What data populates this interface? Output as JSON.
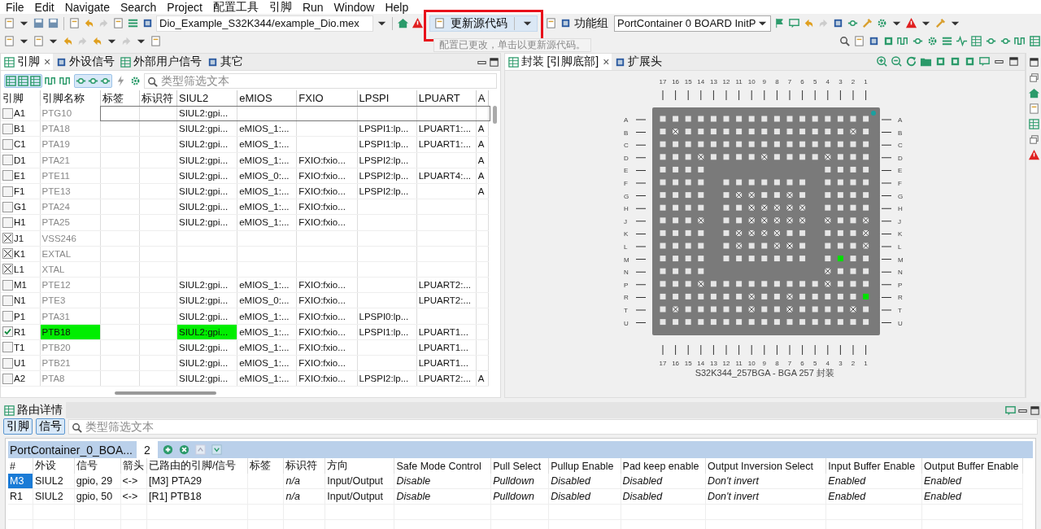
{
  "menu": [
    {
      "label": "File"
    },
    {
      "label": "Edit"
    },
    {
      "label": "Navigate"
    },
    {
      "label": "Search"
    },
    {
      "label": "Project"
    },
    {
      "label": "配置工具"
    },
    {
      "label": "引脚"
    },
    {
      "label": "Run"
    },
    {
      "label": "Window"
    },
    {
      "label": "Help"
    }
  ],
  "toolbar": {
    "project_combo": "Dio_Example_S32K344/example_Dio.mex",
    "update_button": "更新源代码",
    "function_group_label": "功能组",
    "function_group_combo": "PortContainer 0 BOARD InitP",
    "tooltip": "配置已更改，单击以更新源代码。"
  },
  "pins_view": {
    "tabs": [
      {
        "label": "引脚",
        "selected": true,
        "close": "×"
      },
      {
        "label": "外设信号",
        "selected": false
      },
      {
        "label": "外部用户信号",
        "selected": false
      },
      {
        "label": "其它",
        "selected": false
      }
    ],
    "filter": {
      "placeholder": "类型筛选文本"
    },
    "columns": [
      "引脚",
      "引脚名称",
      "标签",
      "标识符",
      "SIUL2",
      "eMIOS",
      "FXIO",
      "LPSPI",
      "LPUART",
      "A"
    ],
    "rows": [
      {
        "kind": "pin",
        "checked": false,
        "selected": true,
        "routed": false,
        "cells": [
          "A1",
          "PTG10",
          null,
          null,
          "SIUL2:gpi...",
          null,
          null,
          null,
          null,
          null
        ]
      },
      {
        "kind": "pin",
        "checked": false,
        "selected": false,
        "routed": false,
        "cells": [
          "B1",
          "PTA18",
          null,
          null,
          "SIUL2:gpi...",
          "eMIOS_1:...",
          null,
          "LPSPI1:lp...",
          "LPUART1:...",
          "A"
        ]
      },
      {
        "kind": "pin",
        "checked": false,
        "selected": false,
        "routed": false,
        "cells": [
          "C1",
          "PTA19",
          null,
          null,
          "SIUL2:gpi...",
          "eMIOS_1:...",
          null,
          "LPSPI1:lp...",
          "LPUART1:...",
          "A"
        ]
      },
      {
        "kind": "pin",
        "checked": false,
        "selected": false,
        "routed": false,
        "cells": [
          "D1",
          "PTA21",
          null,
          null,
          "SIUL2:gpi...",
          "eMIOS_1:...",
          "FXIO:fxio...",
          "LPSPI2:lp...",
          null,
          "A"
        ]
      },
      {
        "kind": "pin",
        "checked": false,
        "selected": false,
        "routed": false,
        "cells": [
          "E1",
          "PTE11",
          null,
          null,
          "SIUL2:gpi...",
          "eMIOS_0:...",
          "FXIO:fxio...",
          "LPSPI2:lp...",
          "LPUART4:...",
          "A"
        ]
      },
      {
        "kind": "pin",
        "checked": false,
        "selected": false,
        "routed": false,
        "cells": [
          "F1",
          "PTE13",
          null,
          null,
          "SIUL2:gpi...",
          "eMIOS_1:...",
          "FXIO:fxio...",
          "LPSPI2:lp...",
          null,
          "A"
        ]
      },
      {
        "kind": "pin",
        "checked": false,
        "selected": false,
        "routed": false,
        "cells": [
          "G1",
          "PTA24",
          null,
          null,
          "SIUL2:gpi...",
          "eMIOS_1:...",
          "FXIO:fxio...",
          null,
          null,
          null
        ]
      },
      {
        "kind": "pin",
        "checked": false,
        "selected": false,
        "routed": false,
        "cells": [
          "H1",
          "PTA25",
          null,
          null,
          "SIUL2:gpi...",
          "eMIOS_1:...",
          "FXIO:fxio...",
          null,
          null,
          null
        ]
      },
      {
        "kind": "power",
        "selected": false,
        "routed": false,
        "cells": [
          "J1",
          "VSS246",
          null,
          null,
          null,
          null,
          null,
          null,
          null,
          null
        ]
      },
      {
        "kind": "power",
        "selected": false,
        "routed": false,
        "cells": [
          "K1",
          "EXTAL",
          null,
          null,
          null,
          null,
          null,
          null,
          null,
          null
        ]
      },
      {
        "kind": "power",
        "selected": false,
        "routed": false,
        "cells": [
          "L1",
          "XTAL",
          null,
          null,
          null,
          null,
          null,
          null,
          null,
          null
        ]
      },
      {
        "kind": "pin",
        "checked": false,
        "selected": false,
        "routed": false,
        "cells": [
          "M1",
          "PTE12",
          null,
          null,
          "SIUL2:gpi...",
          "eMIOS_1:...",
          "FXIO:fxio...",
          null,
          "LPUART2:...",
          null
        ]
      },
      {
        "kind": "pin",
        "checked": false,
        "selected": false,
        "routed": false,
        "cells": [
          "N1",
          "PTE3",
          null,
          null,
          "SIUL2:gpi...",
          "eMIOS_0:...",
          "FXIO:fxio...",
          null,
          "LPUART2:...",
          null
        ]
      },
      {
        "kind": "pin",
        "checked": false,
        "selected": false,
        "routed": false,
        "cells": [
          "P1",
          "PTA31",
          null,
          null,
          "SIUL2:gpi...",
          "eMIOS_1:...",
          "FXIO:fxio...",
          "LPSPI0:lp...",
          null,
          null
        ]
      },
      {
        "kind": "pin",
        "checked": true,
        "selected": false,
        "routed": true,
        "cells": [
          "R1",
          "PTB18",
          null,
          null,
          "SIUL2:gpi...",
          "eMIOS_1:...",
          "FXIO:fxio...",
          "LPSPI1:lp...",
          "LPUART1...",
          null
        ]
      },
      {
        "kind": "pin",
        "checked": false,
        "selected": false,
        "routed": false,
        "cells": [
          "T1",
          "PTB20",
          null,
          null,
          "SIUL2:gpi...",
          "eMIOS_1:...",
          "FXIO:fxio...",
          null,
          "LPUART1...",
          null
        ]
      },
      {
        "kind": "pin",
        "checked": false,
        "selected": false,
        "routed": false,
        "cells": [
          "U1",
          "PTB21",
          null,
          null,
          "SIUL2:gpi...",
          "eMIOS_1:...",
          "FXIO:fxio...",
          null,
          "LPUART1...",
          null
        ]
      },
      {
        "kind": "pin",
        "checked": false,
        "selected": false,
        "routed": false,
        "cells": [
          "A2",
          "PTA8",
          null,
          null,
          "SIUL2:gpi...",
          "eMIOS_1:...",
          "FXIO:fxio...",
          "LPSPI2:lp...",
          "LPUART2:...",
          "A"
        ]
      }
    ]
  },
  "package_view": {
    "tabs": [
      {
        "label": "封装 [引脚底部]",
        "selected": true,
        "close": "×"
      },
      {
        "label": "扩展头",
        "selected": false
      }
    ],
    "top_labels": [
      "17",
      "16",
      "15",
      "14",
      "13",
      "12",
      "11",
      "10",
      "9",
      "8",
      "7",
      "6",
      "5",
      "4",
      "3",
      "2",
      "1"
    ],
    "bottom_labels": [
      "17",
      "16",
      "15",
      "14",
      "13",
      "12",
      "11",
      "10",
      "9",
      "8",
      "7",
      "6",
      "5",
      "4",
      "3",
      "2",
      "1"
    ],
    "left_labels": [
      "A",
      "B",
      "C",
      "D",
      "E",
      "F",
      "G",
      "H",
      "J",
      "K",
      "L",
      "M",
      "N",
      "P",
      "R",
      "T",
      "U"
    ],
    "right_labels": [
      "A",
      "B",
      "C",
      "D",
      "E",
      "F",
      "G",
      "H",
      "J",
      "K",
      "L",
      "M",
      "N",
      "P",
      "R",
      "T",
      "U"
    ],
    "rows": [
      [
        {
          "kind": "pad"
        },
        {
          "kind": "pad"
        },
        {
          "kind": "pad"
        },
        {
          "kind": "pad"
        },
        {
          "kind": "pad"
        },
        {
          "kind": "pad"
        },
        {
          "kind": "pad"
        },
        {
          "kind": "pad"
        },
        {
          "kind": "pad"
        },
        {
          "kind": "pad"
        },
        {
          "kind": "pad"
        },
        {
          "kind": "pad"
        },
        {
          "kind": "pad"
        },
        {
          "kind": "pad"
        },
        {
          "kind": "pad"
        },
        {
          "kind": "pad"
        },
        {
          "kind": "pad"
        }
      ],
      [
        {
          "kind": "pad"
        },
        {
          "kind": "unavailable"
        },
        {
          "kind": "pad"
        },
        {
          "kind": "pad"
        },
        {
          "kind": "pad"
        },
        {
          "kind": "pad"
        },
        {
          "kind": "pad"
        },
        {
          "kind": "pad"
        },
        {
          "kind": "pad"
        },
        {
          "kind": "pad"
        },
        {
          "kind": "pad"
        },
        {
          "kind": "pad"
        },
        {
          "kind": "pad"
        },
        {
          "kind": "pad"
        },
        {
          "kind": "pad"
        },
        {
          "kind": "unavailable"
        },
        {
          "kind": "pad"
        }
      ],
      [
        {
          "kind": "pad"
        },
        {
          "kind": "pad"
        },
        {
          "kind": "pad"
        },
        {
          "kind": "pad"
        },
        {
          "kind": "pad"
        },
        {
          "kind": "pad"
        },
        {
          "kind": "pad"
        },
        {
          "kind": "pad"
        },
        {
          "kind": "pad"
        },
        {
          "kind": "pad"
        },
        {
          "kind": "pad"
        },
        {
          "kind": "pad"
        },
        {
          "kind": "pad"
        },
        {
          "kind": "pad"
        },
        {
          "kind": "pad"
        },
        {
          "kind": "pad"
        },
        {
          "kind": "pad"
        }
      ],
      [
        {
          "kind": "pad"
        },
        {
          "kind": "pad"
        },
        {
          "kind": "pad"
        },
        {
          "kind": "unavailable"
        },
        {
          "kind": "pad"
        },
        {
          "kind": "pad"
        },
        {
          "kind": "pad"
        },
        {
          "kind": "pad"
        },
        {
          "kind": "unavailable"
        },
        {
          "kind": "pad"
        },
        {
          "kind": "pad"
        },
        {
          "kind": "pad"
        },
        {
          "kind": "pad"
        },
        {
          "kind": "unavailable"
        },
        {
          "kind": "pad"
        },
        {
          "kind": "pad"
        },
        {
          "kind": "pad"
        }
      ],
      [
        {
          "kind": "pad"
        },
        {
          "kind": "pad"
        },
        {
          "kind": "pad"
        },
        {
          "kind": "pad"
        },
        null,
        null,
        null,
        null,
        null,
        null,
        null,
        null,
        null,
        {
          "kind": "pad"
        },
        {
          "kind": "pad"
        },
        {
          "kind": "pad"
        },
        {
          "kind": "pad"
        }
      ],
      [
        {
          "kind": "pad"
        },
        {
          "kind": "pad"
        },
        {
          "kind": "pad"
        },
        {
          "kind": "pad"
        },
        null,
        {
          "kind": "pad"
        },
        {
          "kind": "pad"
        },
        {
          "kind": "pad"
        },
        {
          "kind": "pad"
        },
        {
          "kind": "pad"
        },
        {
          "kind": "pad"
        },
        {
          "kind": "pad"
        },
        null,
        {
          "kind": "pad"
        },
        {
          "kind": "pad"
        },
        {
          "kind": "pad"
        },
        {
          "kind": "pad"
        }
      ],
      [
        {
          "kind": "pad"
        },
        {
          "kind": "pad"
        },
        {
          "kind": "pad"
        },
        {
          "kind": "pad"
        },
        null,
        {
          "kind": "pad"
        },
        {
          "kind": "unavailable"
        },
        {
          "kind": "unavailable"
        },
        {
          "kind": "pad"
        },
        {
          "kind": "pad"
        },
        {
          "kind": "unavailable"
        },
        {
          "kind": "pad"
        },
        null,
        {
          "kind": "pad"
        },
        {
          "kind": "pad"
        },
        {
          "kind": "pad"
        },
        {
          "kind": "pad"
        }
      ],
      [
        {
          "kind": "pad"
        },
        {
          "kind": "pad"
        },
        {
          "kind": "pad"
        },
        {
          "kind": "pad"
        },
        null,
        {
          "kind": "pad"
        },
        {
          "kind": "pad"
        },
        {
          "kind": "unavailable"
        },
        {
          "kind": "unavailable"
        },
        {
          "kind": "unavailable"
        },
        {
          "kind": "unavailable"
        },
        {
          "kind": "unavailable"
        },
        null,
        {
          "kind": "pad"
        },
        {
          "kind": "pad"
        },
        {
          "kind": "pad"
        },
        {
          "kind": "pad"
        }
      ],
      [
        {
          "kind": "pad"
        },
        {
          "kind": "pad"
        },
        {
          "kind": "pad"
        },
        {
          "kind": "unavailable"
        },
        null,
        {
          "kind": "pad"
        },
        {
          "kind": "pad"
        },
        {
          "kind": "unavailable"
        },
        {
          "kind": "unavailable"
        },
        {
          "kind": "unavailable"
        },
        {
          "kind": "unavailable"
        },
        {
          "kind": "unavailable"
        },
        null,
        {
          "kind": "unavailable"
        },
        {
          "kind": "pad"
        },
        {
          "kind": "pad"
        },
        {
          "kind": "unavailable"
        }
      ],
      [
        {
          "kind": "pad"
        },
        {
          "kind": "pad"
        },
        {
          "kind": "pad"
        },
        {
          "kind": "pad"
        },
        null,
        {
          "kind": "pad"
        },
        {
          "kind": "unavailable"
        },
        {
          "kind": "unavailable"
        },
        {
          "kind": "unavailable"
        },
        {
          "kind": "unavailable"
        },
        {
          "kind": "pad"
        },
        {
          "kind": "pad"
        },
        null,
        {
          "kind": "pad"
        },
        {
          "kind": "pad"
        },
        {
          "kind": "pad"
        },
        {
          "kind": "unavailable"
        }
      ],
      [
        {
          "kind": "pad"
        },
        {
          "kind": "pad"
        },
        {
          "kind": "pad"
        },
        {
          "kind": "pad"
        },
        null,
        {
          "kind": "pad"
        },
        {
          "kind": "unavailable"
        },
        {
          "kind": "pad"
        },
        {
          "kind": "pad"
        },
        {
          "kind": "unavailable"
        },
        {
          "kind": "unavailable"
        },
        {
          "kind": "pad"
        },
        null,
        {
          "kind": "pad"
        },
        {
          "kind": "pad"
        },
        {
          "kind": "pad"
        },
        {
          "kind": "unavailable"
        }
      ],
      [
        {
          "kind": "pad"
        },
        {
          "kind": "pad"
        },
        {
          "kind": "pad"
        },
        {
          "kind": "pad"
        },
        null,
        {
          "kind": "pad"
        },
        {
          "kind": "pad"
        },
        {
          "kind": "pad"
        },
        {
          "kind": "pad"
        },
        {
          "kind": "pad"
        },
        {
          "kind": "pad"
        },
        {
          "kind": "pad"
        },
        null,
        {
          "kind": "pad"
        },
        {
          "kind": "routed"
        },
        {
          "kind": "pad"
        },
        {
          "kind": "pad"
        }
      ],
      [
        {
          "kind": "pad"
        },
        {
          "kind": "pad"
        },
        {
          "kind": "pad"
        },
        {
          "kind": "pad"
        },
        null,
        null,
        null,
        null,
        null,
        null,
        null,
        null,
        null,
        {
          "kind": "unavailable"
        },
        {
          "kind": "pad"
        },
        {
          "kind": "pad"
        },
        {
          "kind": "pad"
        }
      ],
      [
        {
          "kind": "pad"
        },
        {
          "kind": "pad"
        },
        {
          "kind": "pad"
        },
        {
          "kind": "unavailable"
        },
        {
          "kind": "pad"
        },
        {
          "kind": "pad"
        },
        {
          "kind": "pad"
        },
        {
          "kind": "pad"
        },
        {
          "kind": "pad"
        },
        {
          "kind": "pad"
        },
        {
          "kind": "pad"
        },
        {
          "kind": "pad"
        },
        {
          "kind": "pad"
        },
        {
          "kind": "unavailable"
        },
        {
          "kind": "pad"
        },
        {
          "kind": "pad"
        },
        {
          "kind": "pad"
        }
      ],
      [
        {
          "kind": "pad"
        },
        {
          "kind": "pad"
        },
        {
          "kind": "pad"
        },
        {
          "kind": "pad"
        },
        {
          "kind": "pad"
        },
        {
          "kind": "pad"
        },
        {
          "kind": "pad"
        },
        {
          "kind": "unavailable"
        },
        {
          "kind": "pad"
        },
        {
          "kind": "pad"
        },
        {
          "kind": "unavailable"
        },
        {
          "kind": "pad"
        },
        {
          "kind": "pad"
        },
        {
          "kind": "pad"
        },
        {
          "kind": "pad"
        },
        {
          "kind": "pad"
        },
        {
          "kind": "routed"
        }
      ],
      [
        {
          "kind": "pad"
        },
        {
          "kind": "unavailable"
        },
        {
          "kind": "pad"
        },
        {
          "kind": "pad"
        },
        {
          "kind": "pad"
        },
        {
          "kind": "pad"
        },
        {
          "kind": "pad"
        },
        {
          "kind": "unavailable"
        },
        {
          "kind": "pad"
        },
        {
          "kind": "pad"
        },
        {
          "kind": "unavailable"
        },
        {
          "kind": "pad"
        },
        {
          "kind": "pad"
        },
        {
          "kind": "pad"
        },
        {
          "kind": "pad"
        },
        {
          "kind": "unavailable"
        },
        {
          "kind": "pad"
        }
      ],
      [
        {
          "kind": "pad"
        },
        {
          "kind": "pad"
        },
        {
          "kind": "pad"
        },
        {
          "kind": "pad"
        },
        {
          "kind": "pad"
        },
        {
          "kind": "pad"
        },
        {
          "kind": "pad"
        },
        {
          "kind": "pad"
        },
        {
          "kind": "pad"
        },
        {
          "kind": "pad"
        },
        {
          "kind": "pad"
        },
        {
          "kind": "pad"
        },
        {
          "kind": "pad"
        },
        {
          "kind": "pad"
        },
        {
          "kind": "pad"
        },
        {
          "kind": "pad"
        },
        {
          "kind": "pad"
        }
      ]
    ],
    "caption": "S32K344_257BGA - BGA 257 封装"
  },
  "routing_view": {
    "tab": "路由详情",
    "toggles": [
      {
        "label": "引脚",
        "selected": true
      },
      {
        "label": "信号",
        "selected": true
      }
    ],
    "filter": {
      "placeholder": "类型筛选文本"
    },
    "group": {
      "name": "PortContainer_0_BOA...",
      "count": "2"
    },
    "columns": [
      {
        "label": "#",
        "italic": false
      },
      {
        "label": "外设",
        "italic": false
      },
      {
        "label": "信号",
        "italic": false
      },
      {
        "label": "箭头",
        "italic": false
      },
      {
        "label": "已路由的引脚/信号",
        "italic": false
      },
      {
        "label": "标签"
      },
      {
        "label": "标识符",
        "italic": true
      },
      {
        "label": "方向",
        "italic": false
      },
      {
        "label": "Safe Mode Control",
        "italic": true
      },
      {
        "label": "Pull Select",
        "italic": true
      },
      {
        "label": "Pullup Enable",
        "italic": true
      },
      {
        "label": "Pad keep enable",
        "italic": true
      },
      {
        "label": "Output Inversion Select",
        "italic": true
      },
      {
        "label": "Input Buffer Enable",
        "italic": true
      },
      {
        "label": "Output Buffer Enable",
        "italic": true
      }
    ],
    "rows": [
      {
        "selected": true,
        "cells": [
          "M3",
          "SIUL2",
          "gpio, 29",
          "<->",
          "[M3] PTA29",
          null,
          "n/a",
          "Input/Output",
          "Disable",
          "Pulldown",
          "Disabled",
          "Disabled",
          "Don't invert",
          "Enabled",
          "Enabled"
        ]
      },
      {
        "selected": false,
        "cells": [
          "R1",
          "SIUL2",
          "gpio, 50",
          "<->",
          "[R1] PTB18",
          null,
          "n/a",
          "Input/Output",
          "Disable",
          "Pulldown",
          "Disabled",
          "Disabled",
          "Don't invert",
          "Enabled",
          "Enabled"
        ]
      }
    ]
  }
}
